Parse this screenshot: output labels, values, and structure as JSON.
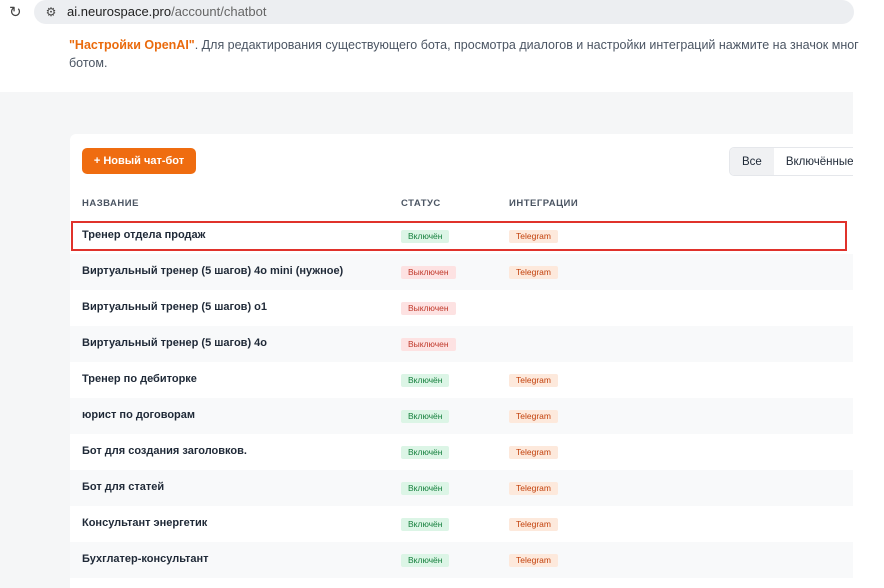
{
  "browser": {
    "url_host": "ai.neurospace.pro",
    "url_path": "/account/chatbot",
    "reload_icon": "reload-icon",
    "site_info_icon": "site-info-icon"
  },
  "notice": {
    "link_text": "\"Настройки OpenAI\"",
    "text_after_link": ". Для редактирования существующего бота, просмотра диалогов и настройки интеграций нажмите на значок мног",
    "line2": "ботом."
  },
  "toolbar": {
    "new_bot_label": "+ Новый чат-бот",
    "filters": [
      "Все",
      "Включённые"
    ],
    "active_filter": "Все"
  },
  "table": {
    "headers": [
      "НАЗВАНИЕ",
      "СТАТУС",
      "ИНТЕГРАЦИИ"
    ],
    "rows": [
      {
        "name": "Тренер отдела продаж",
        "status": "Включён",
        "integration": "Telegram"
      },
      {
        "name": "Виртуальный тренер (5 шагов) 4о mini (нужное)",
        "status": "Выключен",
        "integration": "Telegram"
      },
      {
        "name": "Виртуальный тренер (5 шагов) о1",
        "status": "Выключен",
        "integration": ""
      },
      {
        "name": "Виртуальный тренер (5 шагов) 4о",
        "status": "Выключен",
        "integration": ""
      },
      {
        "name": "Тренер по дебиторке",
        "status": "Включён",
        "integration": "Telegram"
      },
      {
        "name": "юрист по договорам",
        "status": "Включён",
        "integration": "Telegram"
      },
      {
        "name": "Бот для создания заголовков.",
        "status": "Включён",
        "integration": "Telegram"
      },
      {
        "name": "Бот для статей",
        "status": "Включён",
        "integration": "Telegram"
      },
      {
        "name": "Консультант энергетик",
        "status": "Включён",
        "integration": "Telegram"
      },
      {
        "name": "Бухглатер-консультант",
        "status": "Включён",
        "integration": "Telegram"
      }
    ]
  },
  "colors": {
    "accent": "#ef6c10",
    "highlight_border": "#e0322b",
    "status_on": "#15803d",
    "status_off": "#c0392b"
  }
}
